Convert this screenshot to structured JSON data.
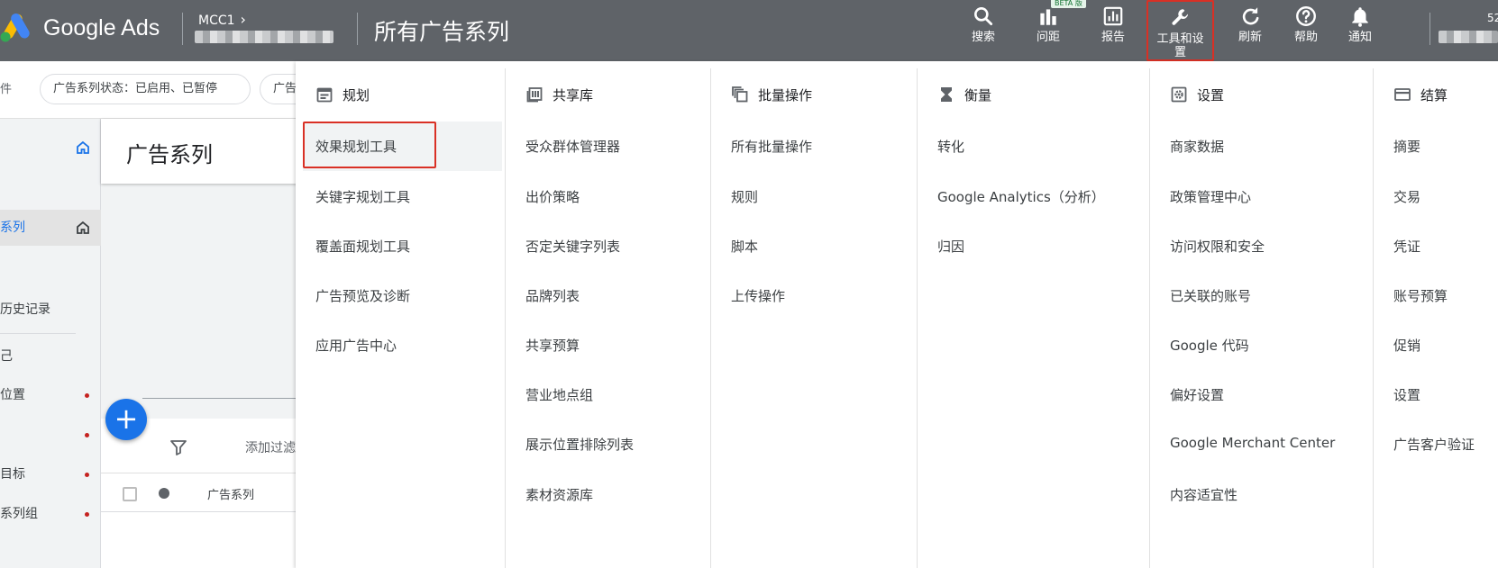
{
  "header": {
    "brand": "Google Ads",
    "account": "MCC1",
    "page_title": "所有广告系列",
    "tools": [
      {
        "label": "搜索",
        "icon": "search-icon"
      },
      {
        "label": "问距",
        "icon": "bar-chart-icon",
        "badge": "BETA 版"
      },
      {
        "label": "报告",
        "icon": "report-icon"
      },
      {
        "label": "工具和设\n置",
        "icon": "wrench-icon",
        "active": true
      },
      {
        "label": "刷新",
        "icon": "refresh-icon"
      },
      {
        "label": "帮助",
        "icon": "help-icon"
      },
      {
        "label": "通知",
        "icon": "bell-icon"
      }
    ],
    "right_partial": "52",
    "colors": {
      "header_bg": "#5f6368",
      "highlight_border": "#d93025"
    }
  },
  "filterbar": {
    "cut_label": "件",
    "chips": [
      "广告系列状态：已启用、已暂停",
      "广告"
    ]
  },
  "sidebar": {
    "items": [
      {
        "label": "系列"
      },
      {
        "label": "历史记录"
      },
      {
        "label": "己"
      },
      {
        "label": "位置"
      },
      {
        "label": ""
      },
      {
        "label": "目标"
      },
      {
        "label": "系列组"
      }
    ]
  },
  "main": {
    "title": "广告系列",
    "add_filter": "添加过滤",
    "column_header": "广告系列"
  },
  "menu": {
    "columns": [
      {
        "title": "规划",
        "icon": "calendar-icon",
        "items": [
          "效果规划工具",
          "关键字规划工具",
          "覆盖面规划工具",
          "广告预览及诊断",
          "应用广告中心"
        ]
      },
      {
        "title": "共享库",
        "icon": "library-icon",
        "items": [
          "受众群体管理器",
          "出价策略",
          "否定关键字列表",
          "品牌列表",
          "共享预算",
          "营业地点组",
          "展示位置排除列表",
          "素材资源库"
        ]
      },
      {
        "title": "批量操作",
        "icon": "copy-icon",
        "items": [
          "所有批量操作",
          "规则",
          "脚本",
          "上传操作"
        ]
      },
      {
        "title": "衡量",
        "icon": "hourglass-icon",
        "items": [
          "转化",
          "Google Analytics（分析）",
          "归因"
        ]
      },
      {
        "title": "设置",
        "icon": "settings-icon",
        "items": [
          "商家数据",
          "政策管理中心",
          "访问权限和安全",
          "已关联的账号",
          "Google 代码",
          "偏好设置",
          "Google Merchant Center",
          "内容适宜性"
        ]
      },
      {
        "title": "结算",
        "icon": "credit-card-icon",
        "items": [
          "摘要",
          "交易",
          "凭证",
          "账号预算",
          "促销",
          "设置",
          "广告客户验证"
        ]
      }
    ]
  }
}
